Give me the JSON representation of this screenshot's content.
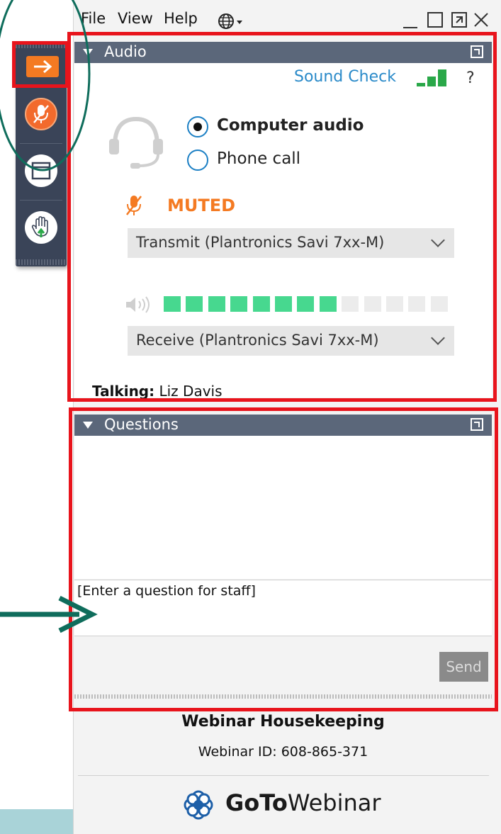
{
  "menu": {
    "items": [
      "File",
      "View",
      "Help"
    ],
    "language_icon": "globe-icon"
  },
  "window_controls": [
    "minimize-icon",
    "maximize-icon",
    "popout-icon",
    "close-icon"
  ],
  "toolbar": {
    "items": [
      "arrow-right-icon",
      "microphone-muted-icon",
      "window-icon",
      "raise-hand-icon"
    ]
  },
  "audio": {
    "title": "Audio",
    "sound_check": "Sound Check",
    "help": "?",
    "options": [
      "Computer audio",
      "Phone call"
    ],
    "selected_option": "Computer audio",
    "status": "MUTED",
    "transmit": "Transmit (Plantronics Savi 7xx-M)",
    "receive": "Receive (Plantronics Savi 7xx-M)",
    "talking_label": "Talking:",
    "talking_name": "Liz Davis",
    "speaker_level": 8,
    "speaker_segments": 13,
    "colors": {
      "accent": "#f47a22",
      "link": "#2a8ac9",
      "meter": "#47d88f",
      "signal": "#2aa849"
    }
  },
  "questions": {
    "title": "Questions",
    "input_value": "[Enter a question for staff]",
    "send_label": "Send"
  },
  "footer": {
    "title": "Webinar Housekeeping",
    "webinar_id": "Webinar ID: 608-865-371",
    "brand_bold": "GoTo",
    "brand_rest": "Webinar"
  },
  "annotation_colors": {
    "highlight_box": "#e8141c",
    "callout": "#0f6d5c"
  }
}
